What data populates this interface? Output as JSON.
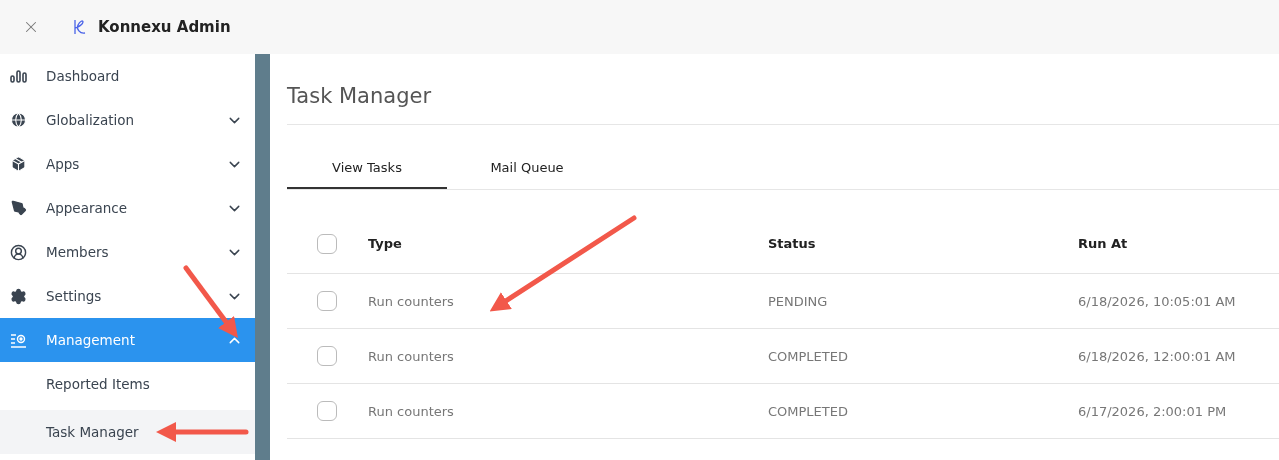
{
  "header": {
    "title": "Konnexu Admin"
  },
  "sidebar": {
    "items": [
      {
        "label": "Dashboard",
        "selected": false
      },
      {
        "label": "Globalization",
        "selected": false,
        "expanded": false
      },
      {
        "label": "Apps",
        "selected": false,
        "expanded": false
      },
      {
        "label": "Appearance",
        "selected": false,
        "expanded": false
      },
      {
        "label": "Members",
        "selected": false,
        "expanded": false
      },
      {
        "label": "Settings",
        "selected": false,
        "expanded": false
      },
      {
        "label": "Management",
        "selected": true,
        "expanded": true,
        "children": [
          {
            "label": "Reported Items",
            "selected": false
          },
          {
            "label": "Task Manager",
            "selected": true
          }
        ]
      }
    ]
  },
  "page": {
    "title": "Task Manager"
  },
  "tabs": [
    {
      "label": "View Tasks",
      "selected": true
    },
    {
      "label": "Mail Queue",
      "selected": false
    }
  ],
  "table": {
    "columns": [
      "Type",
      "Status",
      "Run At"
    ],
    "header_checked": false,
    "rows": [
      {
        "checked": false,
        "cells": [
          "Run counters",
          "PENDING",
          "6/18/2026, 10:05:01 AM"
        ]
      },
      {
        "checked": false,
        "cells": [
          "Run counters",
          "COMPLETED",
          "6/18/2026, 12:00:01 AM"
        ]
      },
      {
        "checked": false,
        "cells": [
          "Run counters",
          "COMPLETED",
          "6/17/2026, 2:00:01 PM"
        ]
      }
    ]
  },
  "annotations": [
    {
      "kind": "arrow"
    },
    {
      "kind": "arrow"
    },
    {
      "kind": "arrow"
    }
  ]
}
